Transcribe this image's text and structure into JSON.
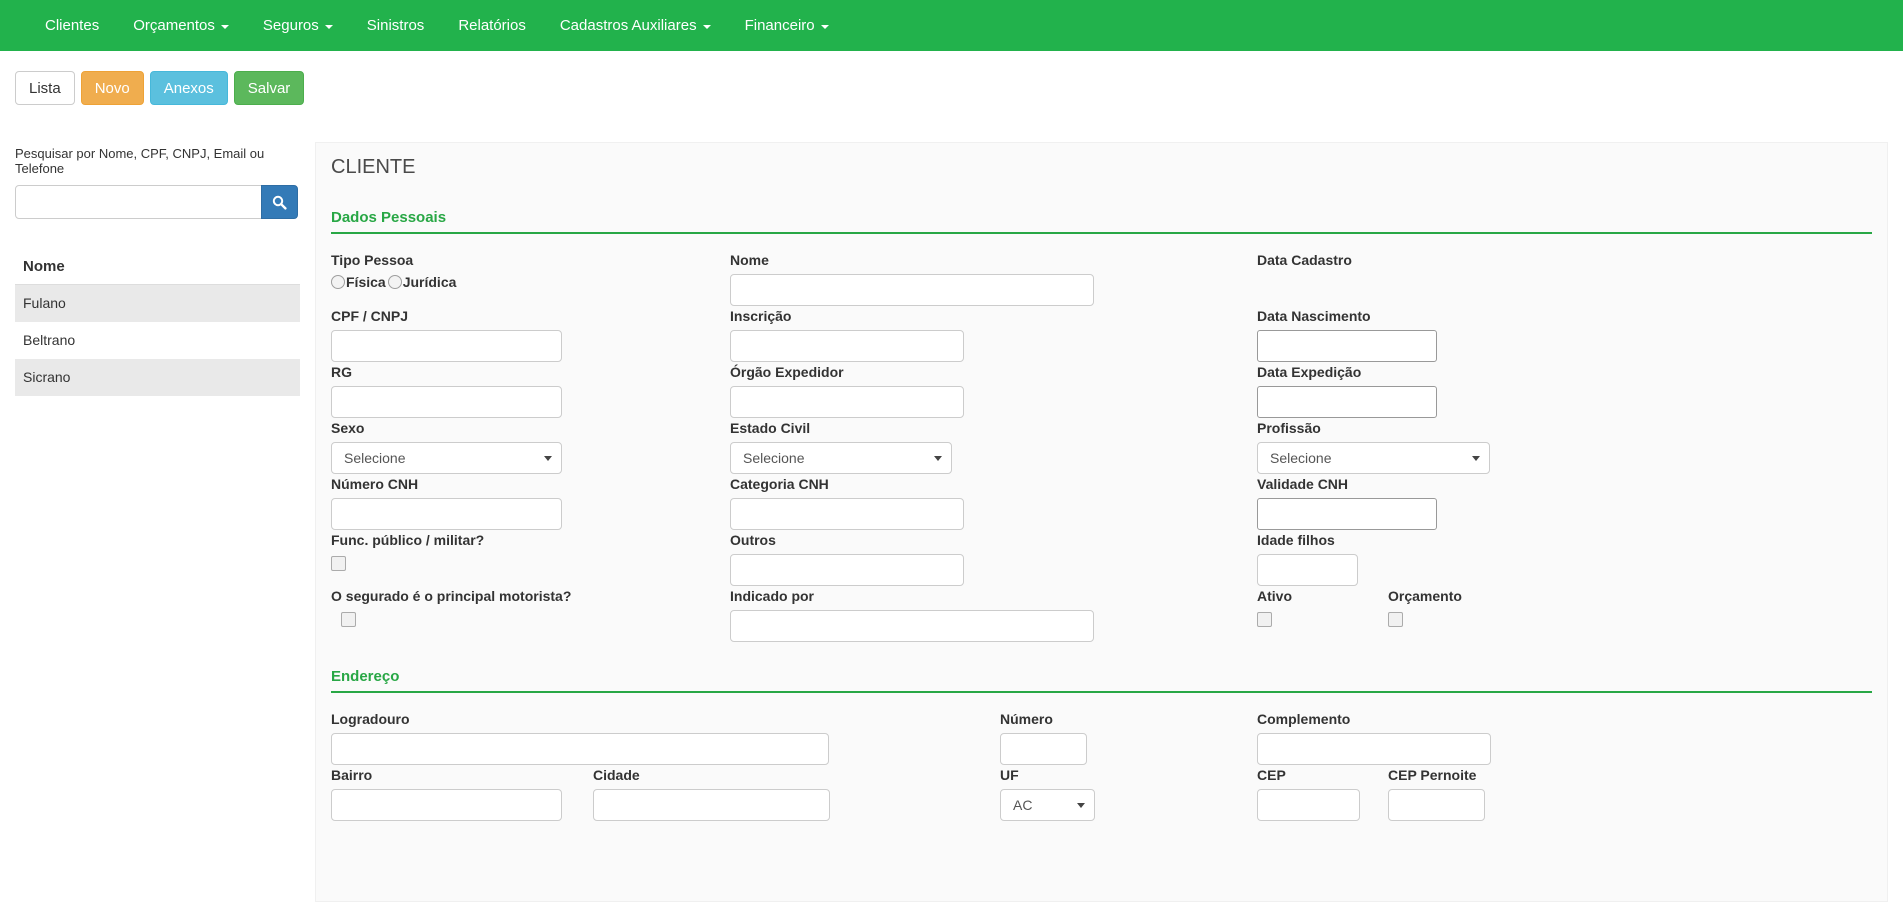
{
  "navbar": {
    "items": [
      {
        "label": "Clientes",
        "has_dropdown": false
      },
      {
        "label": "Orçamentos",
        "has_dropdown": true
      },
      {
        "label": "Seguros",
        "has_dropdown": true
      },
      {
        "label": "Sinistros",
        "has_dropdown": false
      },
      {
        "label": "Relatórios",
        "has_dropdown": false
      },
      {
        "label": "Cadastros Auxiliares",
        "has_dropdown": true
      },
      {
        "label": "Financeiro",
        "has_dropdown": true
      }
    ]
  },
  "toolbar": {
    "lista_label": "Lista",
    "novo_label": "Novo",
    "anexos_label": "Anexos",
    "salvar_label": "Salvar"
  },
  "sidebar": {
    "search_label": "Pesquisar por Nome, CPF, CNPJ, Email ou Telefone",
    "search_value": "",
    "list_header": "Nome",
    "rows": [
      "Fulano",
      "Beltrano",
      "Sicrano"
    ]
  },
  "client_form": {
    "title": "CLIENTE",
    "sections": {
      "dados_pessoais": "Dados Pessoais",
      "endereco": "Endereço"
    },
    "fields": {
      "tipo_pessoa": {
        "label": "Tipo Pessoa",
        "options": [
          "Física",
          "Jurídica"
        ]
      },
      "nome": {
        "label": "Nome",
        "value": ""
      },
      "data_cadastro": {
        "label": "Data Cadastro"
      },
      "cpf_cnpj": {
        "label": "CPF / CNPJ",
        "value": ""
      },
      "inscricao": {
        "label": "Inscrição",
        "value": ""
      },
      "data_nascimento": {
        "label": "Data Nascimento",
        "value": ""
      },
      "rg": {
        "label": "RG",
        "value": ""
      },
      "orgao_expedidor": {
        "label": "Órgão Expedidor",
        "value": ""
      },
      "data_expedicao": {
        "label": "Data Expedição",
        "value": ""
      },
      "sexo": {
        "label": "Sexo",
        "value": "Selecione"
      },
      "estado_civil": {
        "label": "Estado Civil",
        "value": "Selecione"
      },
      "profissao": {
        "label": "Profissão",
        "value": "Selecione"
      },
      "numero_cnh": {
        "label": "Número CNH",
        "value": ""
      },
      "categoria_cnh": {
        "label": "Categoria CNH",
        "value": ""
      },
      "validade_cnh": {
        "label": "Validade CNH",
        "value": ""
      },
      "func_publico": {
        "label": "Func. público / militar?",
        "checked": false
      },
      "outros": {
        "label": "Outros",
        "value": ""
      },
      "idade_filhos": {
        "label": "Idade filhos",
        "value": ""
      },
      "segurado_motorista": {
        "label": "O segurado é o principal motorista?",
        "checked": false
      },
      "indicado_por": {
        "label": "Indicado por",
        "value": ""
      },
      "ativo": {
        "label": "Ativo",
        "checked": false
      },
      "orcamento": {
        "label": "Orçamento",
        "checked": false
      },
      "logradouro": {
        "label": "Logradouro",
        "value": ""
      },
      "numero": {
        "label": "Número",
        "value": ""
      },
      "complemento": {
        "label": "Complemento",
        "value": ""
      },
      "bairro": {
        "label": "Bairro",
        "value": ""
      },
      "cidade": {
        "label": "Cidade",
        "value": ""
      },
      "uf": {
        "label": "UF",
        "value": "AC"
      },
      "cep": {
        "label": "CEP",
        "value": ""
      },
      "cep_pernoite": {
        "label": "CEP Pernoite",
        "value": ""
      }
    }
  },
  "colors": {
    "navbar_green": "#22b24c",
    "section_green": "#28a745",
    "novo_orange": "#f0ad4e",
    "anexos_blue": "#5bc0de",
    "salvar_green": "#5cb85c",
    "lista_border": "#cccccc",
    "search_button_blue": "#337ab7",
    "row_stripe_gray": "#e9e9e9",
    "panel_bg": "#fafafa"
  }
}
